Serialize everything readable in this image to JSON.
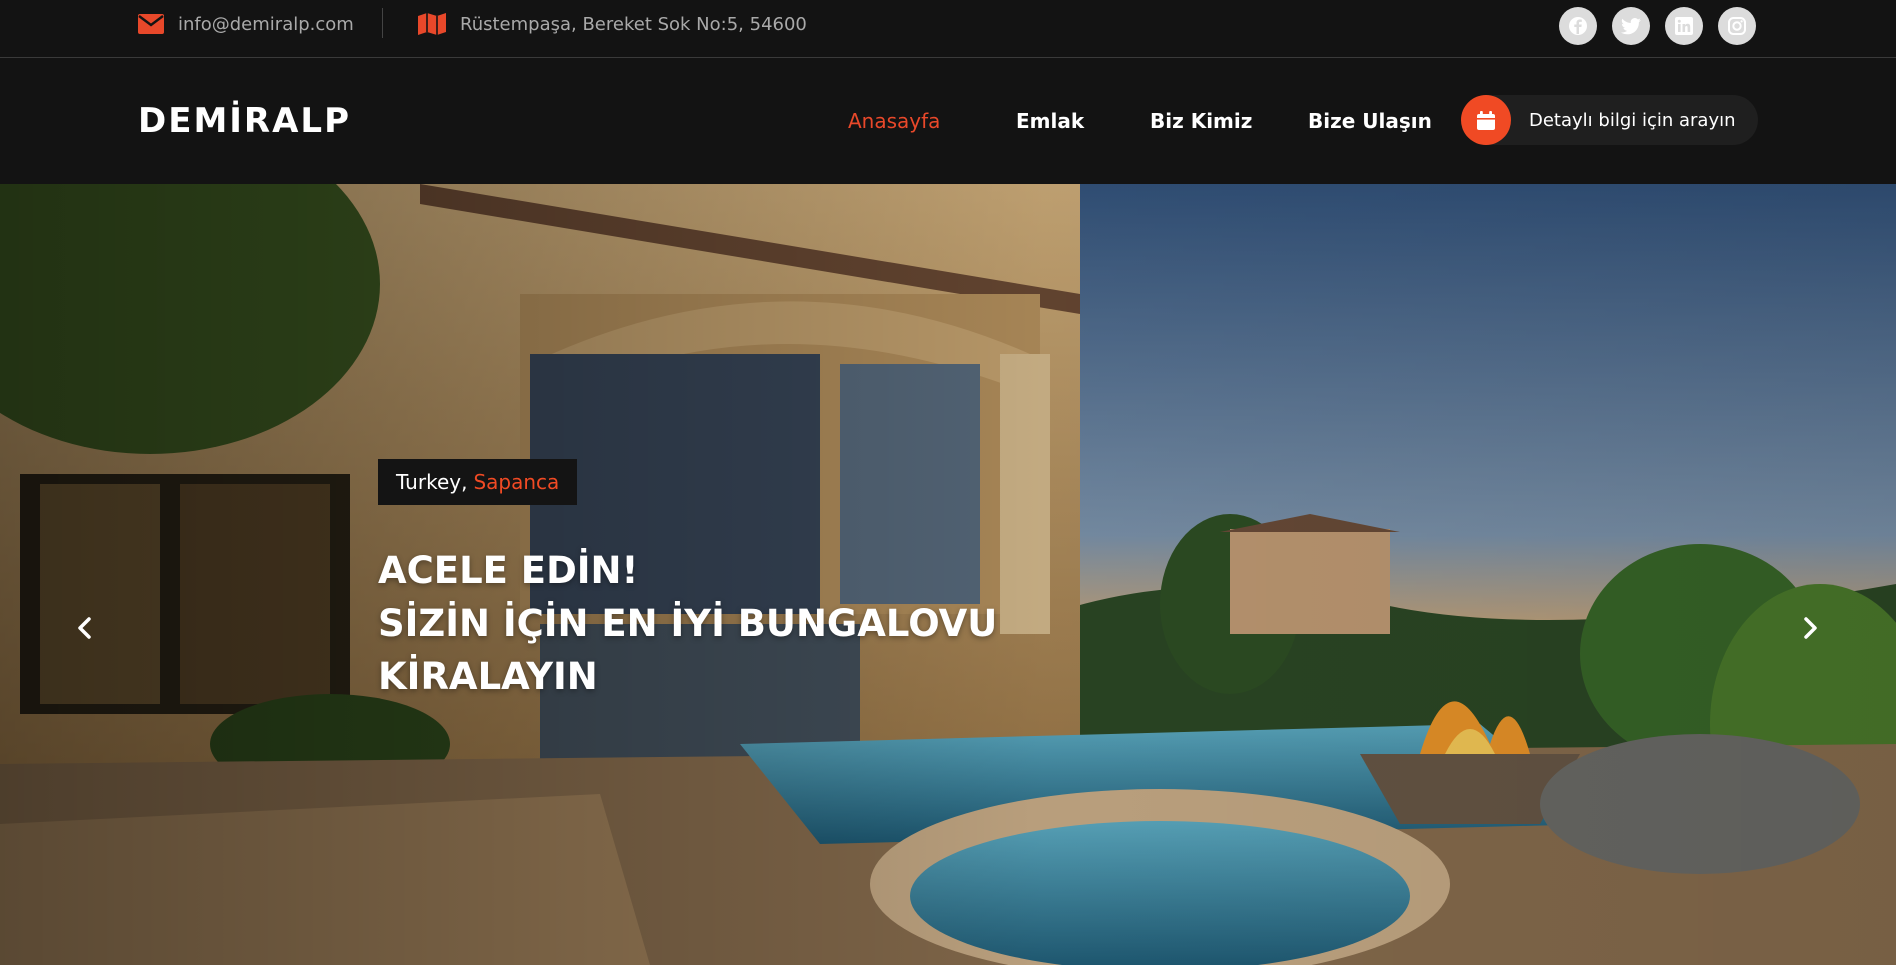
{
  "topbar": {
    "email": "info@demiralp.com",
    "address": "Rüstempaşa, Bereket Sok No:5, 54600",
    "email_icon": "envelope-icon",
    "address_icon": "map-icon",
    "socials": [
      "facebook-icon",
      "twitter-icon",
      "linkedin-icon",
      "instagram-icon"
    ]
  },
  "header": {
    "logo": "DEMİRALP",
    "nav": [
      {
        "label": "Anasayfa",
        "active": true
      },
      {
        "label": "Emlak",
        "active": false
      },
      {
        "label": "Biz Kimiz",
        "active": false
      },
      {
        "label": "Bize Ulaşın",
        "active": false
      }
    ],
    "cta_label": "Detaylı bilgi için arayın",
    "cta_icon": "calendar-icon"
  },
  "hero": {
    "location_country": "Turkey,",
    "location_city": "Sapanca",
    "title_lines": [
      "ACELE EDİN!",
      "SİZİN İÇİN EN İYİ BUNGALOVU",
      "KİRALAYIN"
    ],
    "prev_icon": "chevron-left-icon",
    "next_icon": "chevron-right-icon"
  },
  "colors": {
    "accent": "#f04a24",
    "nav_active": "#e8482a",
    "background": "#131313"
  }
}
